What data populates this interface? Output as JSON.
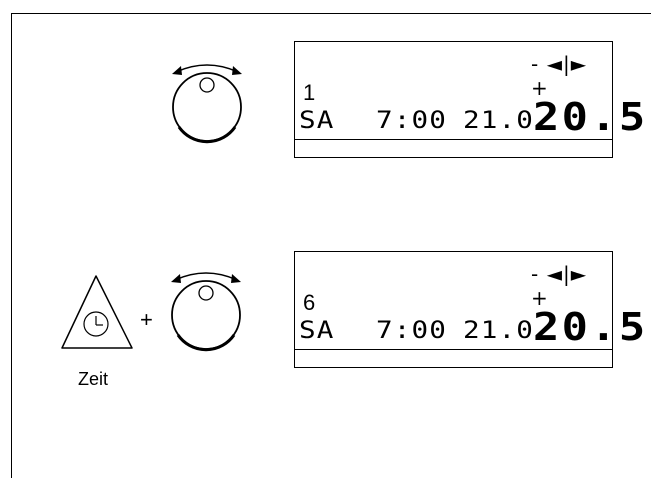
{
  "step1": {
    "display": {
      "mode_indicator": "- ◄|► +",
      "program_number": "1",
      "day": "SA",
      "time": "7:00",
      "setpoint": "21.0",
      "temperature": "20.5"
    }
  },
  "step2": {
    "plus_sign": "+",
    "clock_button_label": "Zeit",
    "display": {
      "mode_indicator": "- ◄|► +",
      "program_number": "6",
      "day": "SA",
      "time": "7:00",
      "setpoint": "21.0",
      "temperature": "20.5"
    }
  }
}
